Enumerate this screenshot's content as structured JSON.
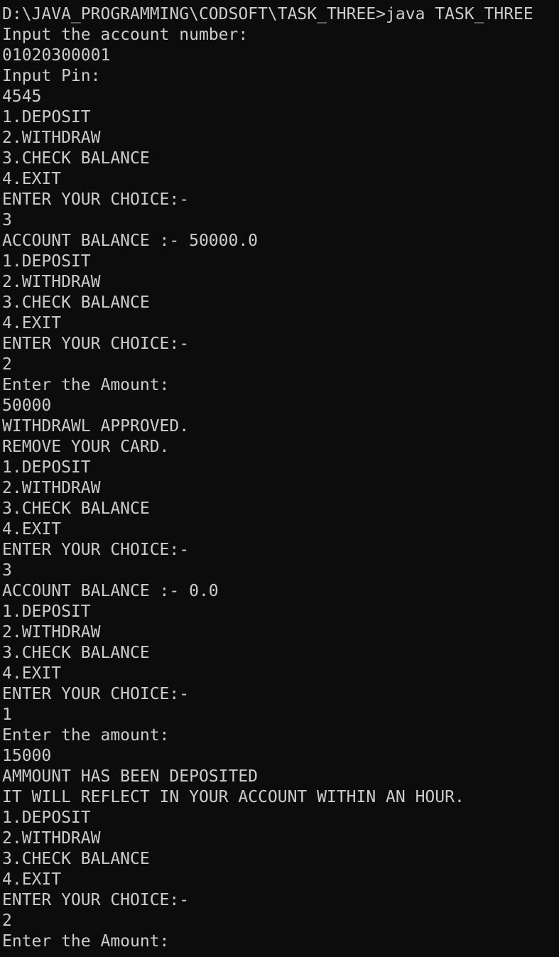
{
  "terminal": {
    "lines": [
      "D:\\JAVA_PROGRAMMING\\CODSOFT\\TASK_THREE>java TASK_THREE",
      "Input the account number:",
      "01020300001",
      "Input Pin:",
      "4545",
      "1.DEPOSIT",
      "2.WITHDRAW",
      "3.CHECK BALANCE",
      "4.EXIT",
      "ENTER YOUR CHOICE:-",
      "3",
      "ACCOUNT BALANCE :- 50000.0",
      "1.DEPOSIT",
      "2.WITHDRAW",
      "3.CHECK BALANCE",
      "4.EXIT",
      "ENTER YOUR CHOICE:-",
      "2",
      "Enter the Amount:",
      "50000",
      "WITHDRAWL APPROVED.",
      "REMOVE YOUR CARD.",
      "1.DEPOSIT",
      "2.WITHDRAW",
      "3.CHECK BALANCE",
      "4.EXIT",
      "ENTER YOUR CHOICE:-",
      "3",
      "ACCOUNT BALANCE :- 0.0",
      "1.DEPOSIT",
      "2.WITHDRAW",
      "3.CHECK BALANCE",
      "4.EXIT",
      "ENTER YOUR CHOICE:-",
      "1",
      "Enter the amount:",
      "15000",
      "AMMOUNT HAS BEEN DEPOSITED",
      "IT WILL REFLECT IN YOUR ACCOUNT WITHIN AN HOUR.",
      "1.DEPOSIT",
      "2.WITHDRAW",
      "3.CHECK BALANCE",
      "4.EXIT",
      "ENTER YOUR CHOICE:-",
      "2",
      "Enter the Amount:"
    ]
  },
  "colors": {
    "background": "#0c0c0c",
    "foreground": "#cccccc"
  }
}
